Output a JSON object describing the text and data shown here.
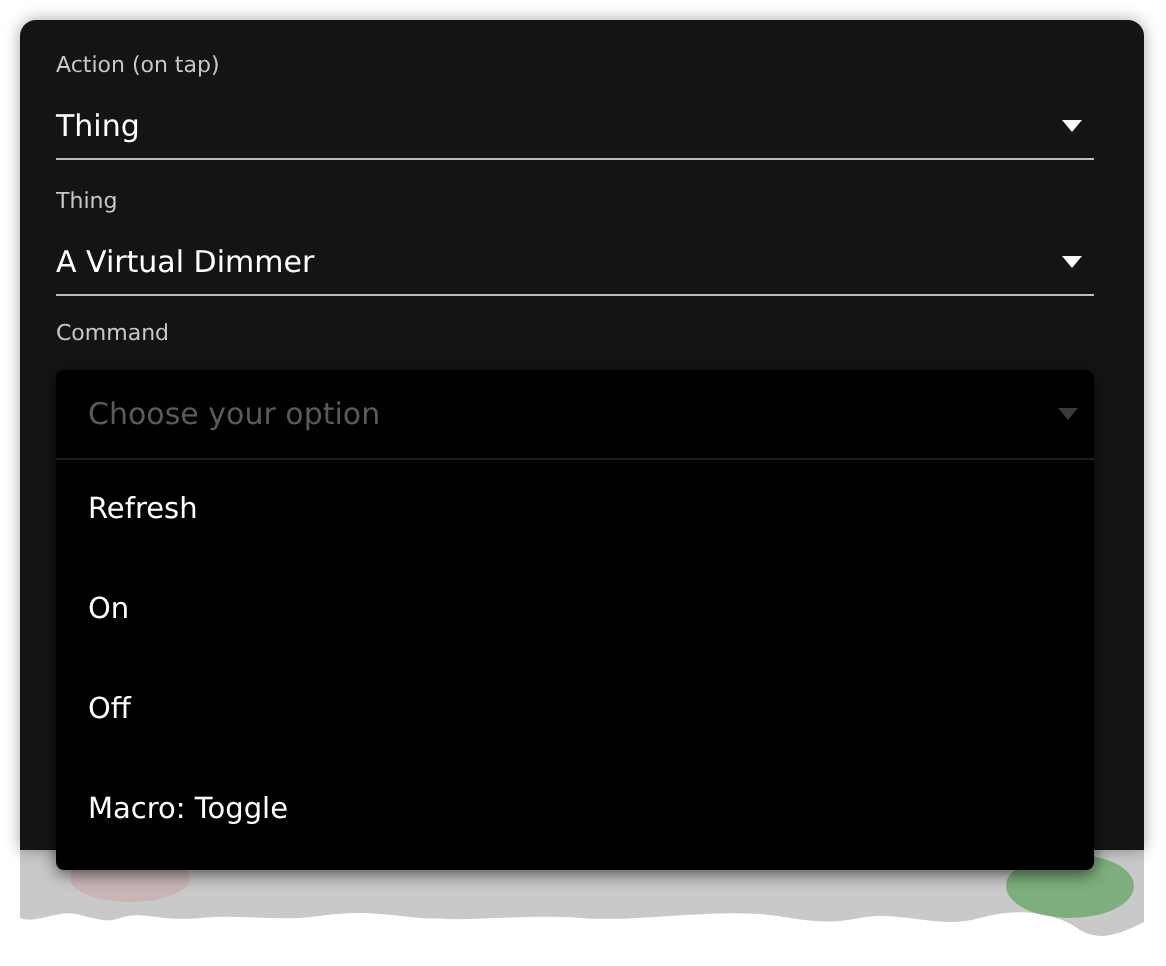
{
  "fields": [
    {
      "label": "Action (on tap)",
      "value": "Thing"
    },
    {
      "label": "Thing",
      "value": "A Virtual Dimmer"
    }
  ],
  "command": {
    "label": "Command",
    "placeholder": "Choose your option",
    "expanded": true,
    "options": [
      {
        "label": "Refresh",
        "selected": false
      },
      {
        "label": "On",
        "selected": false
      },
      {
        "label": "Off",
        "selected": false
      },
      {
        "label": "Macro: Toggle",
        "selected": false
      }
    ]
  }
}
